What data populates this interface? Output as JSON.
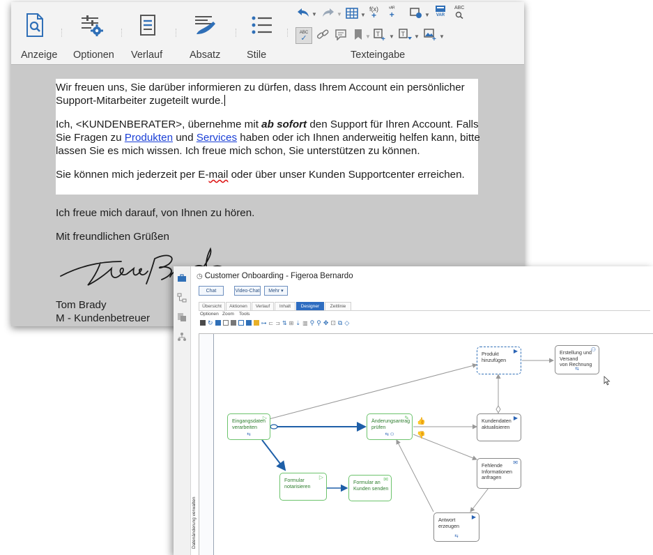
{
  "editor": {
    "ribbon": {
      "buttons": [
        {
          "label": "Anzeige",
          "icon": "search-document-icon"
        },
        {
          "label": "Optionen",
          "icon": "settings-sliders-icon"
        },
        {
          "label": "Verlauf",
          "icon": "history-document-icon"
        },
        {
          "label": "Absatz",
          "icon": "paragraph-brush-icon"
        },
        {
          "label": "Stile",
          "icon": "list-styles-icon"
        }
      ],
      "group_label": "Texteingabe",
      "toolbar_glyphs": {
        "function": "f(x)",
        "var": "VAR",
        "abc": "ABC"
      }
    },
    "letter": {
      "p1": "Wir freuen uns, Sie darüber informieren zu dürfen, dass Ihrem Account ein persönlicher",
      "p1b": "Support-Mitarbeiter zugeteilt wurde.",
      "p2_pre": "Ich, <KUNDENBERATER>, übernehme mit ",
      "p2_bold": "ab sofort",
      "p2_post": " den Support für Ihren Account. Falls",
      "p2b_pre": "Sie Fragen zu ",
      "link_products": "Produkten",
      "p2b_mid": " und ",
      "link_services": "Services",
      "p2b_post": " haben oder ich Ihnen anderweitig helfen kann, bitte",
      "p2c": "lassen Sie es mich wissen. Ich freue mich schon, Sie unterstützen zu können.",
      "p3_pre": "Sie können mich jederzeit per E-",
      "p3_mail": "mail",
      "p3_post": " oder über unser Kunden Supportcenter erreichen.",
      "closing1": "Ich freue mich darauf, von Ihnen zu hören.",
      "closing2": "Mit freundlichen Grüßen",
      "name": "Tom Brady",
      "role": "M - Kundenbetreuer"
    }
  },
  "crm": {
    "title": "Customer Onboarding - Figeroa Bernardo",
    "buttons": {
      "chat": "Chat",
      "video": "Video-Chat",
      "more": "Mehr ▾"
    },
    "tabs": [
      "Übersicht",
      "Aktionen",
      "Verlauf",
      "Inhalt",
      "Designer",
      "Zeitlinie"
    ],
    "active_tab": "Designer",
    "menu": [
      "Optionen",
      "Zoom",
      "Tools"
    ],
    "lane_label": "Datenänderung verwalten",
    "nodes": [
      {
        "id": "eingang",
        "label": "Eingangsdaten\nverarbeiten",
        "color": "green"
      },
      {
        "id": "aenderung",
        "label": "Änderungsantrag\nprüfen",
        "color": "green"
      },
      {
        "id": "formular",
        "label": "Formular\nnotarisieren",
        "color": "green"
      },
      {
        "id": "senden",
        "label": "Formular an\nKunden senden",
        "color": "green"
      },
      {
        "id": "produkt",
        "label": "Produkt\nhinzufügen",
        "color": "gray"
      },
      {
        "id": "rechnung",
        "label": "Erstellung und\nVersand\nvon Rechnung",
        "color": "gray"
      },
      {
        "id": "kundendaten",
        "label": "Kundendaten\naktualisieren",
        "color": "gray"
      },
      {
        "id": "fehlende",
        "label": "Fehlende\nInformationen\nanfragen",
        "color": "gray"
      },
      {
        "id": "antwort",
        "label": "Antwort\nerzeugen",
        "color": "gray"
      }
    ]
  }
}
